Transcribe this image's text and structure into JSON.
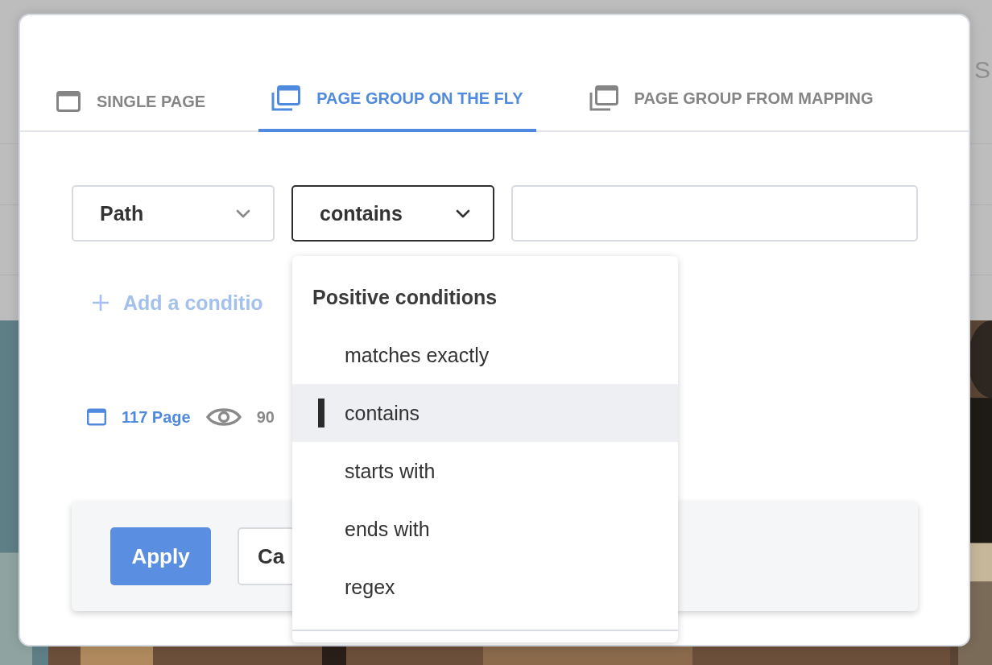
{
  "background": {
    "text": "S"
  },
  "tabs": [
    {
      "label": "SINGLE PAGE",
      "selected": false,
      "kind": "single"
    },
    {
      "label": "PAGE GROUP ON THE FLY",
      "selected": true,
      "kind": "group"
    },
    {
      "label": "PAGE GROUP FROM MAPPING",
      "selected": false,
      "kind": "group"
    }
  ],
  "condition": {
    "field": "Path",
    "operator": "contains",
    "operator_open": true
  },
  "add_condition": "Add a conditio",
  "stats": {
    "pages": "117 Page",
    "views": "90"
  },
  "buttons": {
    "apply": "Apply",
    "cancel": "Ca"
  },
  "operator_menu": {
    "heading": "Positive conditions",
    "options": [
      {
        "label": "matches exactly",
        "selected": false
      },
      {
        "label": "contains",
        "selected": true
      },
      {
        "label": "starts with",
        "selected": false
      },
      {
        "label": "ends with",
        "selected": false
      },
      {
        "label": "regex",
        "selected": false
      }
    ]
  }
}
